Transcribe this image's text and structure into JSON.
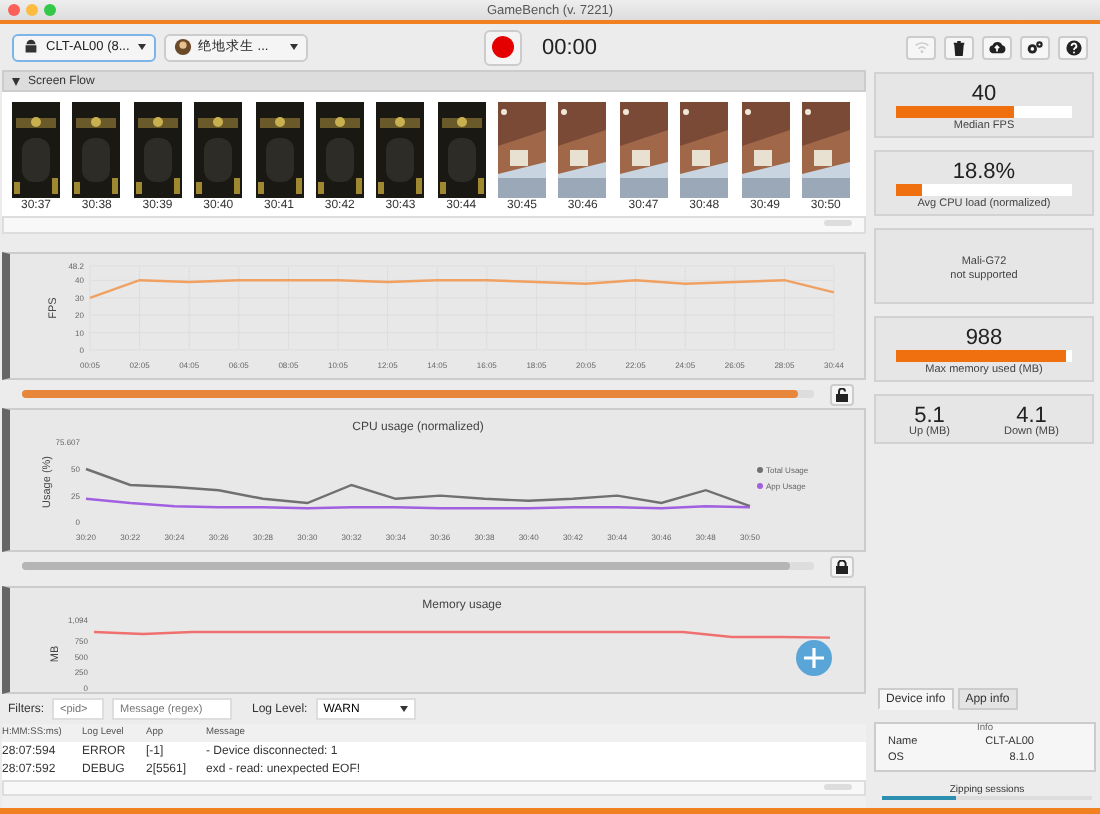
{
  "window": {
    "title": "GameBench (v. 7221)"
  },
  "toolbar": {
    "device": "CLT-AL00 (8...",
    "app": "绝地求生 ...",
    "timer": "00:00"
  },
  "screen_flow": {
    "title": "Screen Flow",
    "expanded": true,
    "frames": [
      {
        "time": "30:37",
        "kind": "picture"
      },
      {
        "time": "30:38",
        "kind": "picture"
      },
      {
        "time": "30:39",
        "kind": "picture"
      },
      {
        "time": "30:40",
        "kind": "picture"
      },
      {
        "time": "30:41",
        "kind": "picture"
      },
      {
        "time": "30:42",
        "kind": "picture"
      },
      {
        "time": "30:43",
        "kind": "picture"
      },
      {
        "time": "30:44",
        "kind": "picture"
      },
      {
        "time": "30:45",
        "kind": "picture"
      },
      {
        "time": "30:46",
        "kind": "picture"
      },
      {
        "time": "30:47",
        "kind": "picture"
      },
      {
        "time": "30:48",
        "kind": "picture"
      },
      {
        "time": "30:49",
        "kind": "picture"
      },
      {
        "time": "30:50",
        "kind": "picture"
      }
    ]
  },
  "fps_panel": {
    "slider": {
      "level": 0.98
    },
    "chart_data": {
      "type": "line",
      "grid": true,
      "ylabel": "FPS",
      "categories": [
        "00:05",
        "02:05",
        "04:05",
        "06:05",
        "08:05",
        "10:05",
        "12:05",
        "14:05",
        "16:05",
        "18:05",
        "20:05",
        "22:05",
        "24:05",
        "26:05",
        "28:05",
        "30:44"
      ],
      "ylim": [
        0,
        48.2
      ],
      "yticks": [
        0,
        10,
        20,
        30,
        40,
        {
          "value": 48.2,
          "label": "48.2"
        }
      ],
      "series": [
        {
          "color": "#f0a060",
          "values": [
            30,
            40,
            39,
            40,
            40,
            40,
            39,
            40,
            40,
            39,
            38,
            40,
            38,
            39,
            40,
            33
          ]
        }
      ]
    }
  },
  "cpu_panel": {
    "slider": {
      "level": 0.97
    },
    "chart_data": {
      "type": "line",
      "legend": true,
      "title": "CPU usage (normalized)",
      "ylabel": "Usage (%)",
      "categories": [
        "30:20",
        "30:22",
        "30:24",
        "30:26",
        "30:28",
        "30:30",
        "30:32",
        "30:34",
        "30:36",
        "30:38",
        "30:40",
        "30:42",
        "30:44",
        "30:46",
        "30:48",
        "30:50"
      ],
      "ylim": [
        0,
        75.607
      ],
      "yticks": [
        0,
        25,
        50,
        {
          "value": 75.607,
          "label": "75.607"
        }
      ],
      "series": [
        {
          "name": "Total Usage",
          "color": "#707070",
          "values": [
            50,
            35,
            33,
            30,
            22,
            18,
            35,
            22,
            25,
            22,
            20,
            22,
            25,
            18,
            30,
            15
          ]
        },
        {
          "name": "App Usage",
          "color": "#a060e0",
          "values": [
            22,
            18,
            15,
            14,
            14,
            13,
            14,
            14,
            13,
            13,
            13,
            14,
            14,
            13,
            15,
            14
          ]
        }
      ]
    }
  },
  "memory_panel": {
    "chart_data": {
      "type": "line",
      "title": "Memory usage",
      "ylabel": "MB",
      "ylim": [
        0,
        1094
      ],
      "yticks": [
        0,
        250,
        500,
        750,
        {
          "value": 1094,
          "label": "1,094"
        }
      ],
      "series": [
        {
          "color": "#f07070",
          "values": [
            900,
            870,
            900,
            900,
            900,
            900,
            900,
            900,
            900,
            900,
            900,
            900,
            900,
            820,
            820,
            810
          ]
        }
      ]
    }
  },
  "filters": {
    "label": "Filters:",
    "pid_placeholder": "<pid>",
    "message_placeholder": "Message (regex)",
    "log_level_label": "Log Level:",
    "log_level": "WARN"
  },
  "log": {
    "columns": [
      "H:MM:SS:ms)",
      "Log Level",
      "App",
      "Message"
    ],
    "rows": [
      [
        "28:07:594",
        "ERROR",
        "[-1]",
        "- Device disconnected: 1"
      ],
      [
        "28:07:592",
        "DEBUG",
        "2[5561]",
        "exd - read: unexpected EOF!"
      ]
    ]
  },
  "stats": [
    {
      "kind": "meter",
      "value": "40",
      "level": 0.67,
      "label": "Median FPS"
    },
    {
      "kind": "meter",
      "value": "18.8%",
      "level": 0.15,
      "label": "Avg CPU load (normalized)"
    },
    {
      "kind": "text",
      "lines": [
        "Mali-G72",
        "not supported"
      ]
    },
    {
      "kind": "meter",
      "value": "988",
      "level": 0.97,
      "label": "Max memory used (MB)"
    },
    {
      "kind": "pair",
      "items": [
        {
          "value": "5.1",
          "label": "Up (MB)"
        },
        {
          "value": "4.1",
          "label": "Down (MB)"
        }
      ]
    }
  ],
  "info": {
    "tabs": [
      {
        "label": "Device info",
        "selected": true
      },
      {
        "label": "App info",
        "selected": false
      }
    ],
    "header": "Info",
    "rows": [
      {
        "name": "Name",
        "value": "CLT-AL00"
      },
      {
        "name": "OS",
        "value": "8.1.0"
      }
    ],
    "status": {
      "text": "Zipping sessions",
      "level": 0.35
    }
  }
}
